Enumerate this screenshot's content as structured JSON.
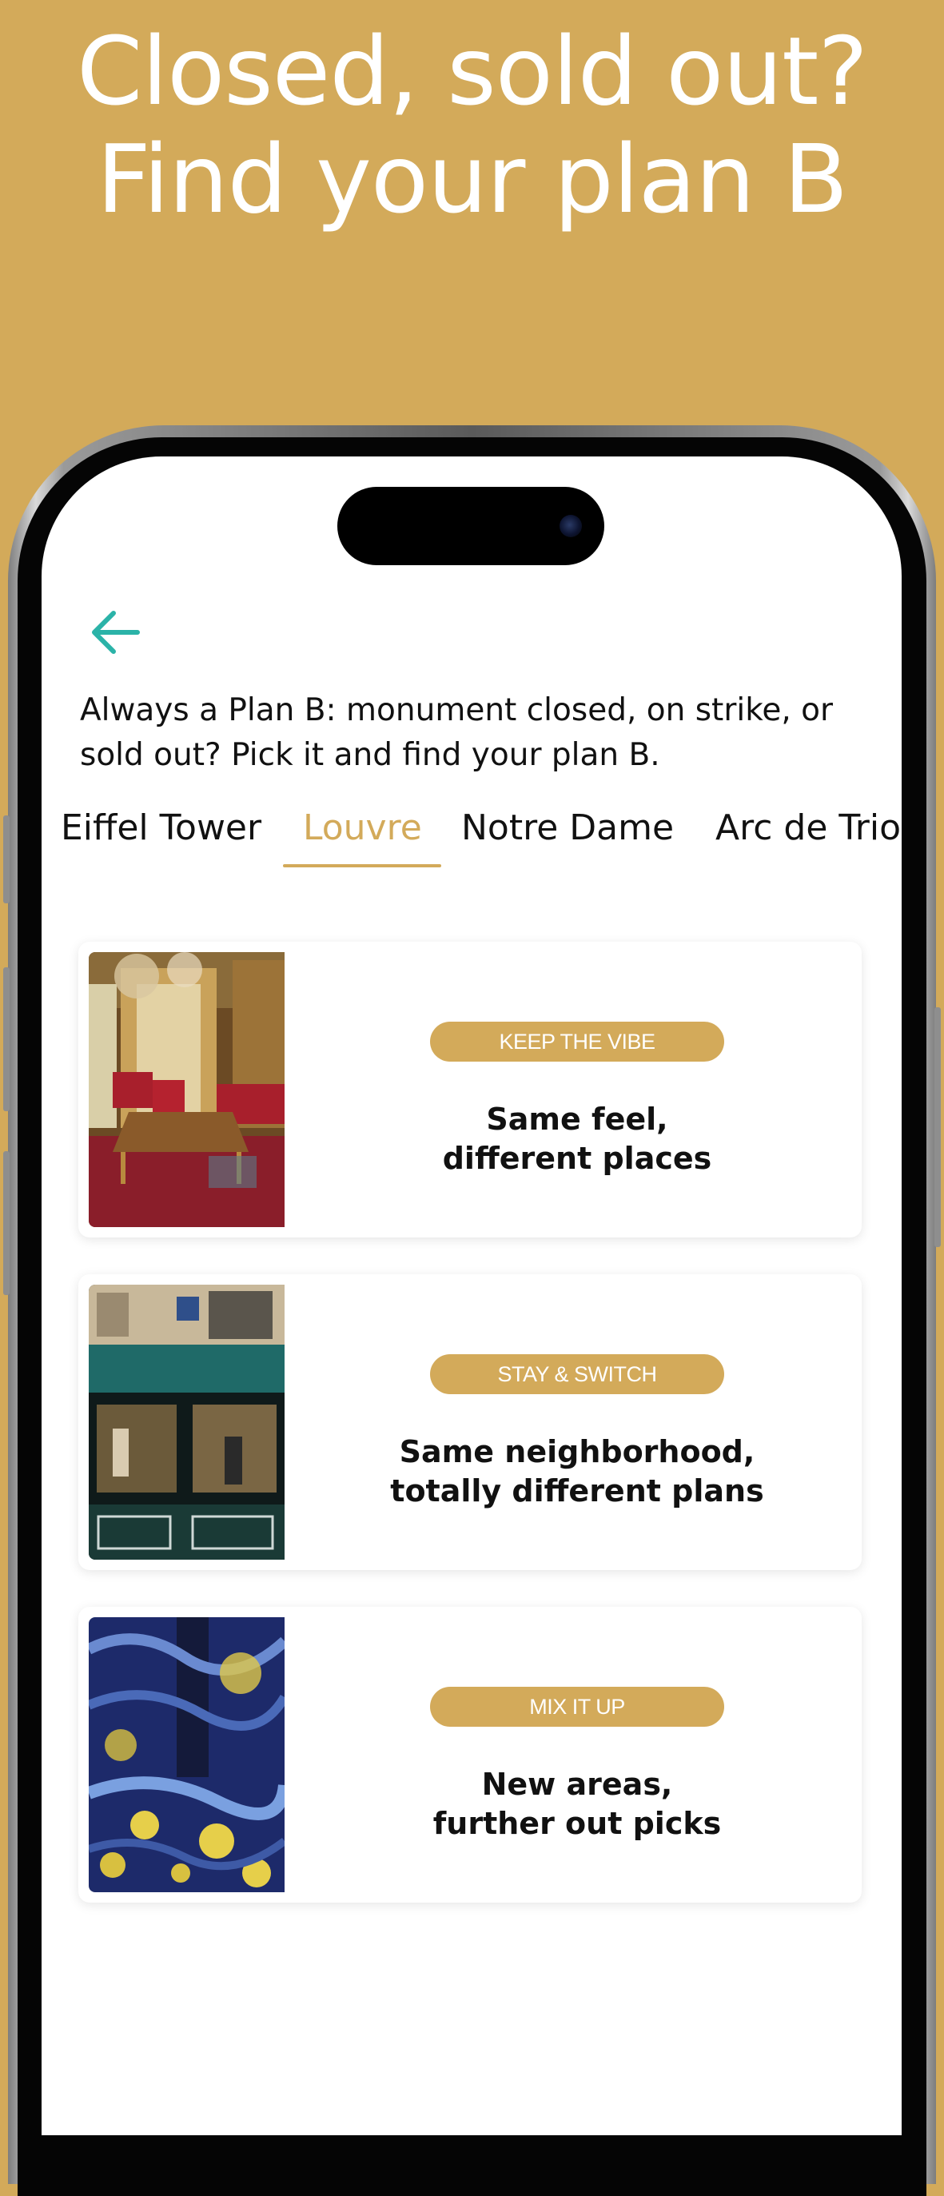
{
  "headline": {
    "line1": "Closed, sold out?",
    "line2": "Find your plan B"
  },
  "screen": {
    "back_icon": "arrow-left-icon",
    "intro_text": "Always a Plan B: monument closed, on strike, or sold out? Pick it and find your plan B.",
    "tabs": [
      {
        "label": "Eiffel Tower",
        "active": false
      },
      {
        "label": "Louvre",
        "active": true
      },
      {
        "label": "Notre Dame",
        "active": false
      },
      {
        "label": "Arc de Triomphe",
        "active": false
      }
    ],
    "cards": [
      {
        "badge": "KEEP THE VIBE",
        "title_line1": "Same feel,",
        "title_line2": "different places",
        "image": "ornate-louvre-apartment-photo"
      },
      {
        "badge": "STAY & SWITCH",
        "title_line1": "Same neighborhood,",
        "title_line2": "totally different plans",
        "image": "parisian-storefront-photo"
      },
      {
        "badge": "MIX IT UP",
        "title_line1": "New areas,",
        "title_line2": "further out picks",
        "image": "starry-night-immersive-exhibit-photo"
      }
    ]
  },
  "colors": {
    "background": "#D3AA5A",
    "accent": "#D3AA5A",
    "back_arrow": "#2BB3A8",
    "text": "#111111"
  }
}
